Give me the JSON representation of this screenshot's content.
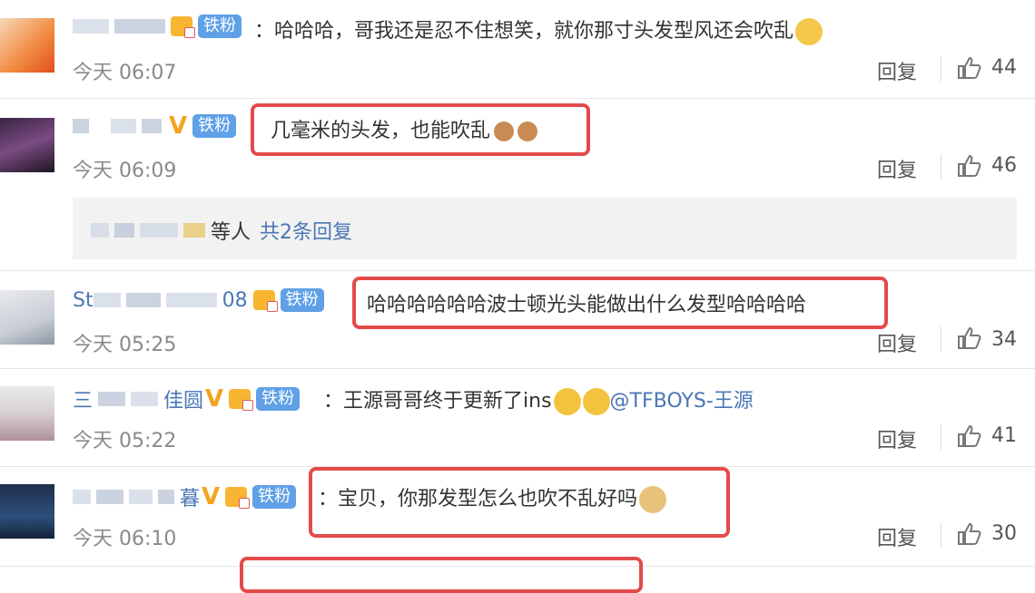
{
  "comments": [
    {
      "name_visible": "",
      "text": "哈哈哈，哥我还是忍不住想笑，就你那寸头发型风还会吹乱",
      "fan_label": "铁粉",
      "time": "今天 06:07",
      "reply_label": "回复",
      "likes": "44"
    },
    {
      "name_visible": "",
      "text": "几毫米的头发，也能吹乱",
      "fan_label": "铁粉",
      "time": "今天 06:09",
      "reply_label": "回复",
      "likes": "46"
    },
    {
      "name_visible": "St…08",
      "name_prefix": "St",
      "name_suffix": "08",
      "text": "哈哈哈哈哈哈波士顿光头能做出什么发型哈哈哈哈",
      "fan_label": "铁粉",
      "time": "今天 05:25",
      "reply_label": "回复",
      "likes": "34"
    },
    {
      "name_prefix": "三",
      "name_suffix": "佳圆",
      "text": "王源哥哥终于更新了ins",
      "mention": "@TFBOYS-王源",
      "fan_label": "铁粉",
      "time": "今天 05:22",
      "reply_label": "回复",
      "likes": "41"
    },
    {
      "name_suffix": "暮",
      "text": "宝贝，你那发型怎么也吹不乱好吗",
      "fan_label": "铁粉",
      "time": "今天 06:10",
      "reply_label": "回复",
      "likes": "30"
    }
  ],
  "sub_reply": {
    "suffix": "等人",
    "count_label": "共2条回复"
  },
  "colors": {
    "link": "#4b77b5",
    "fan_badge": "#5fa0e6",
    "highlight": "#e34b4b",
    "vip": "#f4a321"
  }
}
